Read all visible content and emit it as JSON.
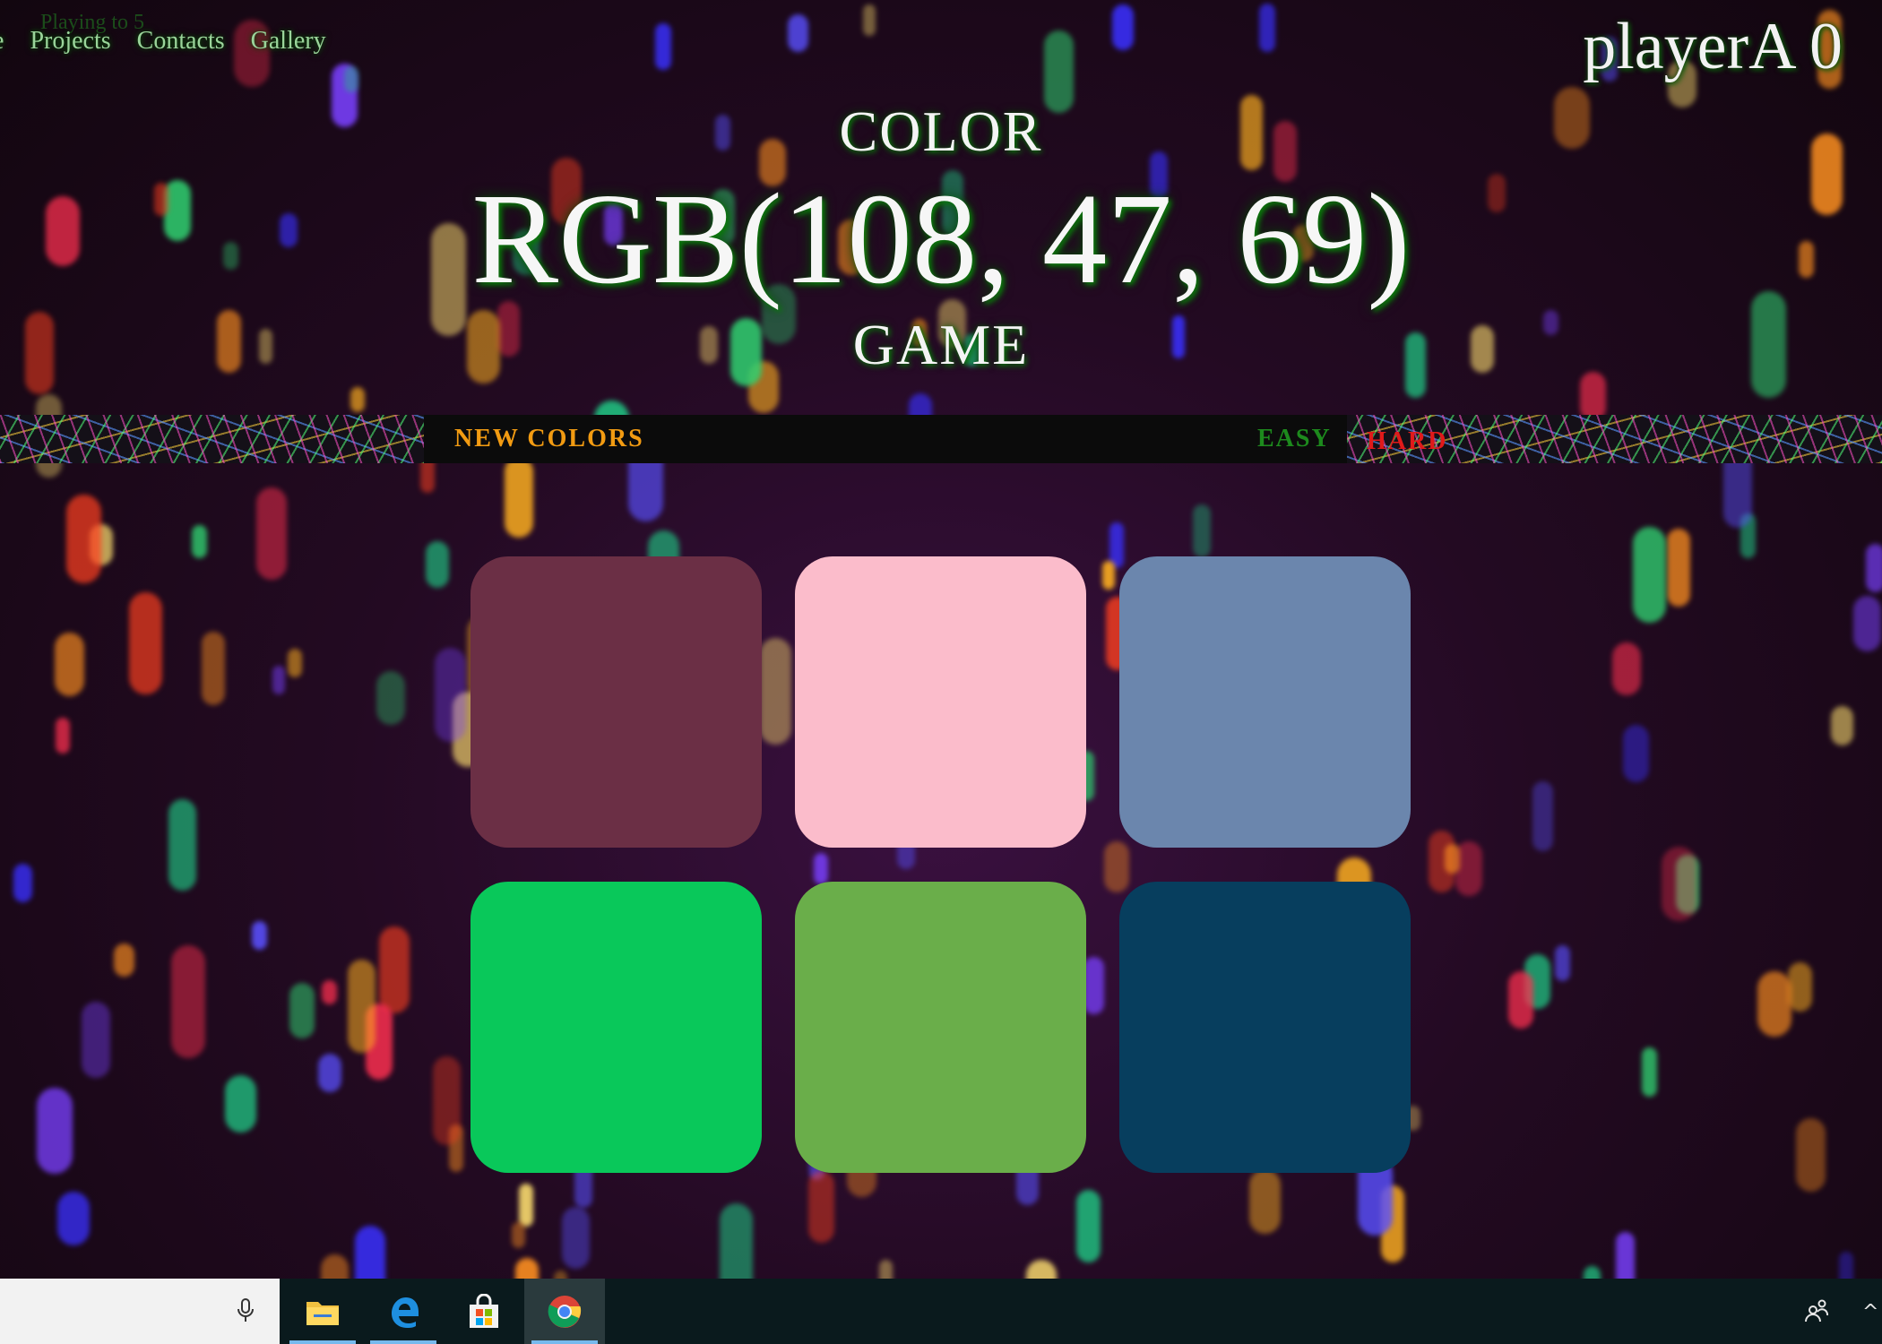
{
  "nav": {
    "partial_item": "e",
    "items": [
      "Projects",
      "Contacts",
      "Gallery"
    ],
    "ghost_text": "Playing to 5"
  },
  "player": {
    "label": "playerA 0"
  },
  "header": {
    "line1": "COLOR",
    "rgb": "RGB(108, 47, 69)",
    "line3": "GAME"
  },
  "controls": {
    "new_colors": "NEW COLORS",
    "easy": "EASY",
    "hard": "HARD"
  },
  "squares": [
    {
      "name": "square-1",
      "color": "#6b2f45"
    },
    {
      "name": "square-2",
      "color": "#fbbccb"
    },
    {
      "name": "square-3",
      "color": "#6b86ad"
    },
    {
      "name": "square-4",
      "color": "#09c85a"
    },
    {
      "name": "square-5",
      "color": "#6aae4a"
    },
    {
      "name": "square-6",
      "color": "#073e5e"
    }
  ],
  "taskbar": {
    "icons": [
      "microphone-icon",
      "file-explorer-icon",
      "edge-icon",
      "store-icon",
      "chrome-icon",
      "people-icon",
      "chevron-up-icon"
    ]
  },
  "colors": {
    "new_colors": "#f29b12",
    "easy": "#1d8a1d",
    "hard": "#e01a1a",
    "title_text": "#f4f4f4",
    "title_glow": "#0b7a0b"
  }
}
